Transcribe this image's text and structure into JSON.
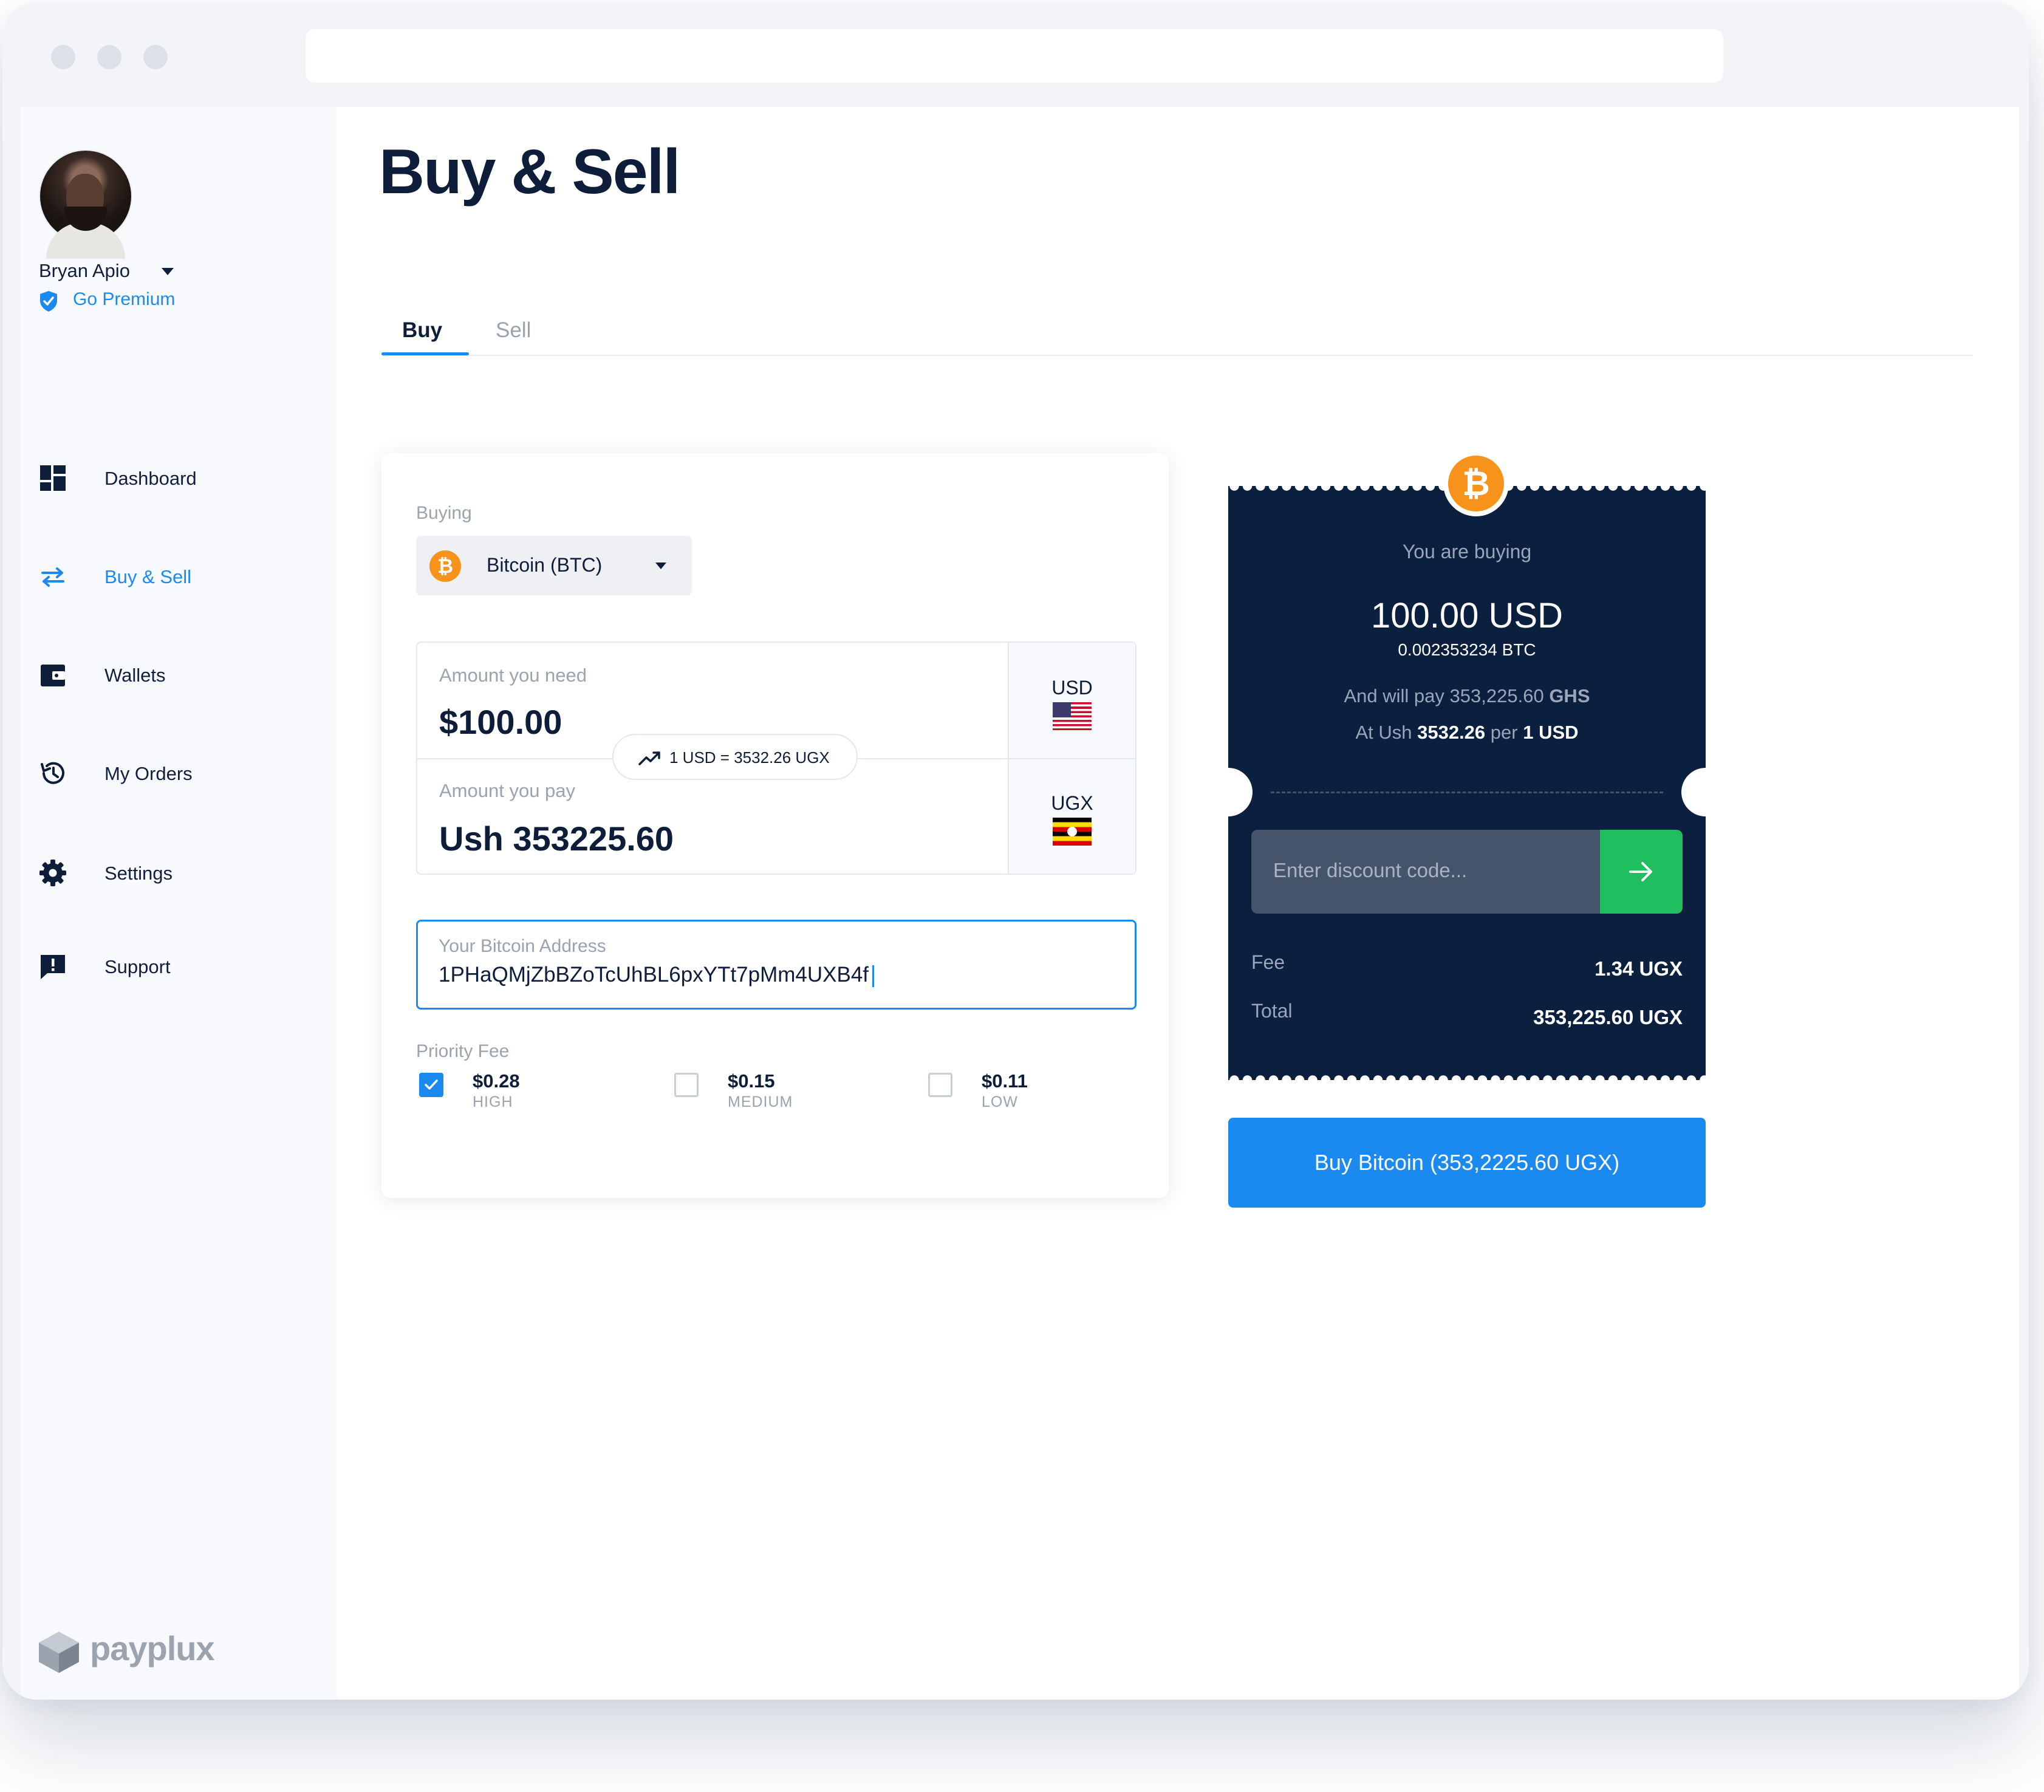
{
  "user": {
    "name": "Bryan Apio",
    "premium_label": "Go Premium"
  },
  "sidebar": {
    "items": [
      {
        "label": "Dashboard",
        "icon": "dashboard-icon",
        "active": false
      },
      {
        "label": "Buy & Sell",
        "icon": "swap-arrows-icon",
        "active": true
      },
      {
        "label": "Wallets",
        "icon": "wallet-icon",
        "active": false
      },
      {
        "label": "My Orders",
        "icon": "history-icon",
        "active": false
      },
      {
        "label": "Settings",
        "icon": "gear-icon",
        "active": false
      },
      {
        "label": "Support",
        "icon": "chat-alert-icon",
        "active": false
      }
    ],
    "brand": "payplux"
  },
  "page": {
    "title": "Buy & Sell"
  },
  "tabs": [
    {
      "label": "Buy",
      "active": true
    },
    {
      "label": "Sell",
      "active": false
    }
  ],
  "form": {
    "buying_label": "Buying",
    "coin": {
      "name": "Bitcoin (BTC)",
      "icon": "bitcoin-icon",
      "symbol": "₿"
    },
    "amount_need": {
      "label": "Amount you need",
      "value": "$100.00",
      "currency": "USD"
    },
    "amount_pay": {
      "label": "Amount you pay",
      "value": "Ush 353225.60",
      "currency": "UGX"
    },
    "rate": "1 USD = 3532.26 UGX",
    "address": {
      "label": "Your Bitcoin Address",
      "value": "1PHaQMjZbBZoTcUhBL6pxYTt7pMm4UXB4f"
    },
    "priority_fee_label": "Priority Fee",
    "fees": [
      {
        "value": "$0.28",
        "tier": "HIGH",
        "checked": true
      },
      {
        "value": "$0.15",
        "tier": "MEDIUM",
        "checked": false
      },
      {
        "value": "$0.11",
        "tier": "LOW",
        "checked": false
      }
    ]
  },
  "summary": {
    "you_are_buying": "You are buying",
    "amount": "100.00 USD",
    "btc_amount": "0.002353234 BTC",
    "pay_prefix": "And will pay 353,225.60",
    "pay_currency": "GHS",
    "rate_prefix": "At Ush",
    "rate_value": "3532.26",
    "rate_per": "per",
    "rate_unit": "1 USD",
    "discount_placeholder": "Enter discount code...",
    "fee_label": "Fee",
    "fee_value": "1.34 UGX",
    "total_label": "Total",
    "total_value": "353,225.60 UGX"
  },
  "buy_button": "Buy Bitcoin (353,2225.60 UGX)",
  "colors": {
    "accent": "#1b8af0",
    "ticket": "#0b1f3f",
    "bitcoin": "#f7931a",
    "go": "#1fbf5f"
  }
}
